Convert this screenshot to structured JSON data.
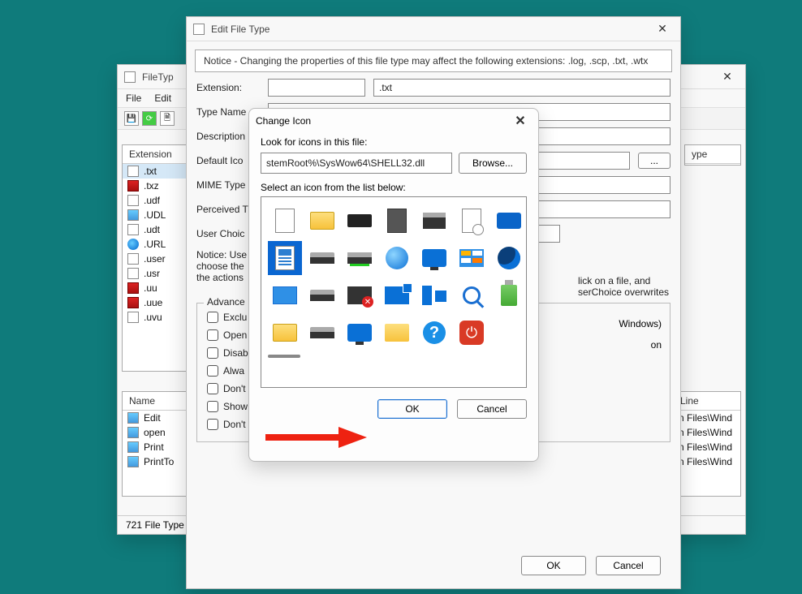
{
  "bgWindow": {
    "title": "FileTyp",
    "menu": [
      "File",
      "Edit"
    ],
    "extHeader": "Extension",
    "extList": [
      {
        "ext": ".txt",
        "iconClass": "doc",
        "selected": true
      },
      {
        "ext": ".txz",
        "iconClass": "red"
      },
      {
        "ext": ".udf",
        "iconClass": "doc"
      },
      {
        "ext": ".UDL",
        "iconClass": "note"
      },
      {
        "ext": ".udt",
        "iconClass": "doc"
      },
      {
        "ext": ".URL",
        "iconClass": "globe"
      },
      {
        "ext": ".user",
        "iconClass": "doc"
      },
      {
        "ext": ".usr",
        "iconClass": "doc"
      },
      {
        "ext": ".uu",
        "iconClass": "red"
      },
      {
        "ext": ".uue",
        "iconClass": "red"
      },
      {
        "ext": ".uvu",
        "iconClass": "doc"
      }
    ],
    "nameHeader": "Name",
    "verbs": [
      "Edit",
      "open",
      "Print",
      "PrintTo"
    ],
    "rightHeader1": "ype",
    "rightHeader2": "Line",
    "rightRows": [
      "n Files\\Wind",
      "n Files\\Wind",
      "n Files\\Wind",
      "n Files\\Wind"
    ],
    "status": "721 File Type"
  },
  "editWindow": {
    "title": "Edit File Type",
    "notice": "Notice - Changing the properties of this file type may affect the following extensions: .log, .scp, .txt, .wtx",
    "fields": {
      "extensionLabel": "Extension:",
      "extensionValue": ".txt",
      "typeNameLabel": "Type Name",
      "descriptionLabel": "Description",
      "defaultIconLabel": "Default Ico",
      "mimeTypeLabel": "MIME Type",
      "perceivedLabel": "Perceived T",
      "userChoiceLabel": "User Choic",
      "ellipsisBtn": "..."
    },
    "userChoiceNotice": "Notice: UserChoice specifies the Registry key that is opened when you double-click on a file, and choose the 'Open with' option. If UserChoice is specified, UserChoice overwrites the actions",
    "userChoiceVisible": [
      "lick on a file, and",
      "serChoice overwrites"
    ],
    "advanced": {
      "groupLabel": "Advance",
      "checkboxes": [
        {
          "label": "Exclu",
          "full": "Exclude"
        },
        {
          "label": "Open",
          "full": "Open"
        },
        {
          "label": "Disab",
          "full": "Disable"
        },
        {
          "label": "Alwa",
          "full": "Always"
        },
        {
          "label": "Don't add this file type to Recent Documents",
          "partial": "Don't"
        },
        {
          "label": "Show this file type in the 'New' menu of Explorer"
        },
        {
          "label": "Don't open inside a Web browser window"
        }
      ],
      "rightText1": "Windows)",
      "rightText2": "on"
    },
    "buttons": {
      "ok": "OK",
      "cancel": "Cancel"
    }
  },
  "changeIcon": {
    "title": "Change Icon",
    "lookLabel": "Look for icons in this file:",
    "filePath": "stemRoot%\\SysWow64\\SHELL32.dll",
    "browse": "Browse...",
    "selectLabel": "Select an icon from the list below:",
    "icons": [
      {
        "name": "blank-page-icon",
        "cls": "i-page"
      },
      {
        "name": "folder-icon",
        "cls": "i-folder"
      },
      {
        "name": "drive-icon",
        "cls": "i-drive"
      },
      {
        "name": "chip-icon",
        "cls": "i-chip"
      },
      {
        "name": "printer-icon",
        "cls": "i-printer"
      },
      {
        "name": "recent-page-icon",
        "cls": "i-clock"
      },
      {
        "name": "window-tile-icon",
        "cls": "i-tile"
      },
      {
        "name": "text-document-icon",
        "cls": "i-doc",
        "selected": true
      },
      {
        "name": "hard-disk-icon",
        "cls": "i-hd"
      },
      {
        "name": "hard-disk-green-icon",
        "cls": "i-hdg"
      },
      {
        "name": "globe-icon",
        "cls": "i-globe"
      },
      {
        "name": "monitor-globe-icon",
        "cls": "i-mon"
      },
      {
        "name": "programs-icon",
        "cls": "i-app"
      },
      {
        "name": "night-mode-icon",
        "cls": "i-moon"
      },
      {
        "name": "diskette-icon",
        "cls": "i-disk"
      },
      {
        "name": "dark-drive-icon",
        "cls": "i-hd"
      },
      {
        "name": "monitor-remove-icon",
        "cls": "i-monx"
      },
      {
        "name": "network-monitor-icon",
        "cls": "i-nets"
      },
      {
        "name": "network-icon",
        "cls": "i-net2"
      },
      {
        "name": "search-icon",
        "cls": "i-search"
      },
      {
        "name": "usb-green-arrow-icon",
        "cls": "i-usb"
      },
      {
        "name": "folder-yellow-icon",
        "cls": "i-folder"
      },
      {
        "name": "drive-gray-icon",
        "cls": "i-hd"
      },
      {
        "name": "monitor-blue-icon",
        "cls": "i-mon"
      },
      {
        "name": "folder-window-icon",
        "cls": "i-foldw"
      },
      {
        "name": "help-icon",
        "cls": "i-help",
        "glyph": "?"
      },
      {
        "name": "power-icon",
        "cls": "i-power",
        "glyph": "⏻"
      }
    ],
    "ok": "OK",
    "cancel": "Cancel"
  }
}
